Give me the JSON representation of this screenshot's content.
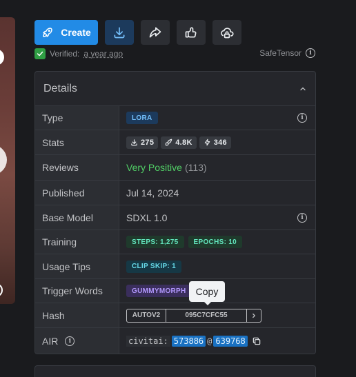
{
  "toolbar": {
    "create_label": "Create"
  },
  "verified": {
    "label": "Verified:",
    "time": "a year ago"
  },
  "safetensor": {
    "label": "SafeTensor"
  },
  "details": {
    "title": "Details",
    "rows": {
      "type": {
        "label": "Type",
        "badge": "LORA"
      },
      "stats": {
        "label": "Stats",
        "downloads": "275",
        "generations": "4.8K",
        "buzz": "346"
      },
      "reviews": {
        "label": "Reviews",
        "sentiment": "Very Positive",
        "count": "(113)"
      },
      "published": {
        "label": "Published",
        "value": "Jul 14, 2024"
      },
      "base_model": {
        "label": "Base Model",
        "value": "SDXL 1.0"
      },
      "training": {
        "label": "Training",
        "steps": "STEPS: 1,275",
        "epochs": "EPOCHS: 10"
      },
      "usage_tips": {
        "label": "Usage Tips",
        "clip_skip": "CLIP SKIP: 1"
      },
      "trigger_words": {
        "label": "Trigger Words",
        "word": "GUMMYMORPH"
      },
      "hash": {
        "label": "Hash",
        "algo": "AUTOV2",
        "value": "095C7CFC55"
      },
      "air": {
        "label": "AIR",
        "prefix": "civitai:",
        "model_id": "573886",
        "at": "@",
        "version_id": "639768"
      }
    }
  },
  "tooltip": {
    "text": "Copy"
  },
  "colors": {
    "accent": "#228be6",
    "positive": "#51cf66",
    "verified": "#2f9e44"
  }
}
